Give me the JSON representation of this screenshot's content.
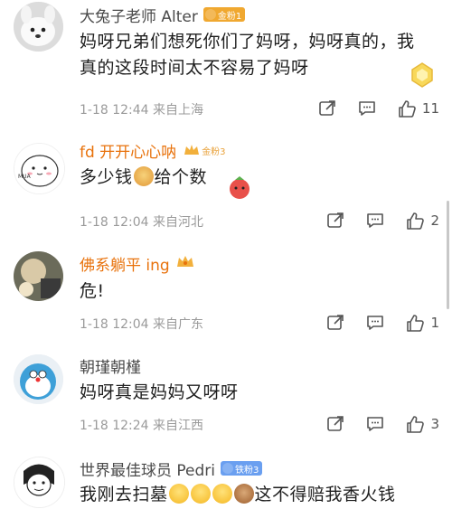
{
  "comments": [
    {
      "username": "大兔子老师 Alter",
      "badge": "金粉1",
      "text": "妈呀兄弟们想死你们了妈呀，妈呀真的，我真的这段时间太不容易了妈呀",
      "meta": "1-18 12:44  来自上海",
      "likes": "11"
    },
    {
      "username": "fd 开开心心呐",
      "badge": "金粉3",
      "text_before": "多少钱",
      "text_after": "给个数",
      "meta": "1-18 12:04  来自河北",
      "likes": "2"
    },
    {
      "username": "佛系躺平 ing",
      "text": "危!",
      "meta": "1-18 12:04  来自广东",
      "likes": "1"
    },
    {
      "username": "朝瑾朝槿",
      "text": "妈呀真是妈妈又呀呀",
      "meta": "1-18 12:24  来自江西",
      "likes": "3"
    },
    {
      "username": "世界最佳球员 Pedri",
      "badge": "铁粉3",
      "text_before": "我刚去扫墓",
      "text_after": "这不得赔我香火钱"
    }
  ],
  "colors": {
    "vip_name": "#e8720c",
    "gold_badge": "#f0a830",
    "iron_badge": "#6a9ff0",
    "meta_gray": "#9a9a9a"
  },
  "icons": [
    "share-icon",
    "comment-icon",
    "like-icon",
    "doge-emoji",
    "laugh-emoji",
    "monkey-emoji",
    "sticker-icon"
  ]
}
